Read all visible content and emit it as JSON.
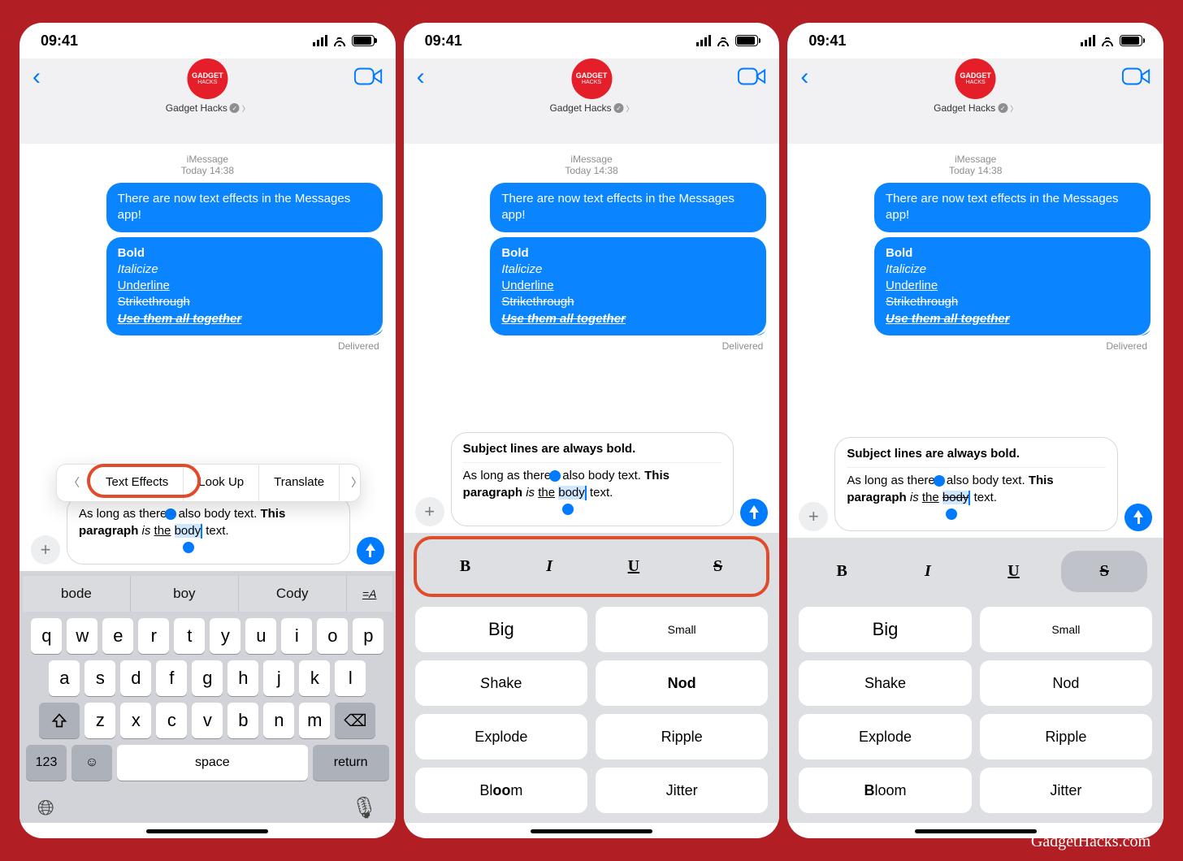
{
  "watermark": "GadgetHacks.com",
  "status_time": "09:41",
  "contact_name": "Gadget Hacks",
  "avatar_line1": "GADGET",
  "avatar_line2": "HACKS",
  "stamp_imsg": "iMessage",
  "stamp_time": "Today 14:38",
  "bubble1": "There are now text effects in the Messages app!",
  "styles": {
    "bold": "Bold",
    "italic": "Italicize",
    "underline": "Underline",
    "strike": "Strikethrough",
    "all": "Use them all together"
  },
  "delivered": "Delivered",
  "compose_subject": "Subject lines are always bold.",
  "compose_body_pre": "As long as there",
  "compose_body_mid": " also body text. ",
  "compose_body_this": "This paragraph",
  "compose_body_is": " is ",
  "compose_body_the": "the",
  "compose_body_sp": " ",
  "compose_body_body": "body",
  "compose_body_end": " text.",
  "context_menu": {
    "text_effects": "Text Effects",
    "look_up": "Look Up",
    "translate": "Translate"
  },
  "suggestions": [
    "bode",
    "boy",
    "Cody"
  ],
  "kbd_123": "123",
  "kbd_space": "space",
  "kbd_return": "return",
  "bius": {
    "b": "B",
    "i": "I",
    "u": "U",
    "s": "S"
  },
  "fx": {
    "big": "Big",
    "small": "Small",
    "shake": "Shake",
    "nod": "Nod",
    "explode": "Explode",
    "ripple": "Ripple",
    "bloom": "Bloom",
    "jitter": "Jitter"
  }
}
